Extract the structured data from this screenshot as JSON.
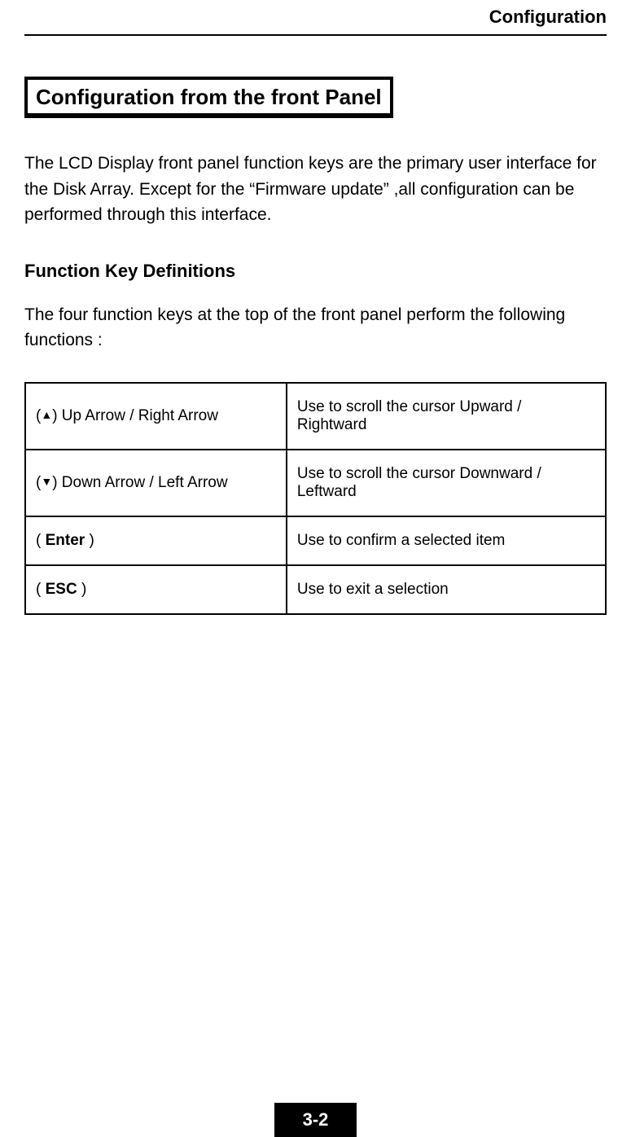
{
  "header": {
    "title": "Configuration"
  },
  "section": {
    "title": "Configuration from the front Panel"
  },
  "intro_paragraph": "The LCD Display front panel function keys are the primary user interface for the Disk Array. Except for the “Firmware update” ,all configuration can be performed through this interface.",
  "sub_heading": "Function Key Definitions",
  "sub_paragraph": "The four function keys at the top of the front panel perform the following functions :",
  "rows": [
    {
      "prefix": "(",
      "icon": "▲",
      "suffix": ") Up Arrow / Right Arrow",
      "desc": "Use to scroll the cursor Upward / Rightward"
    },
    {
      "prefix": "(",
      "icon": "▼",
      "suffix": ") Down Arrow / Left Arrow",
      "desc": "Use to scroll the cursor Downward / Leftward"
    },
    {
      "key_open": "( ",
      "key_bold": "Enter",
      "key_close": " )",
      "desc": "Use to confirm a selected item"
    },
    {
      "key_open": "( ",
      "key_bold": "ESC",
      "key_close": " )",
      "desc": "Use to exit a selection"
    }
  ],
  "footer": {
    "page_number": "3-2"
  }
}
